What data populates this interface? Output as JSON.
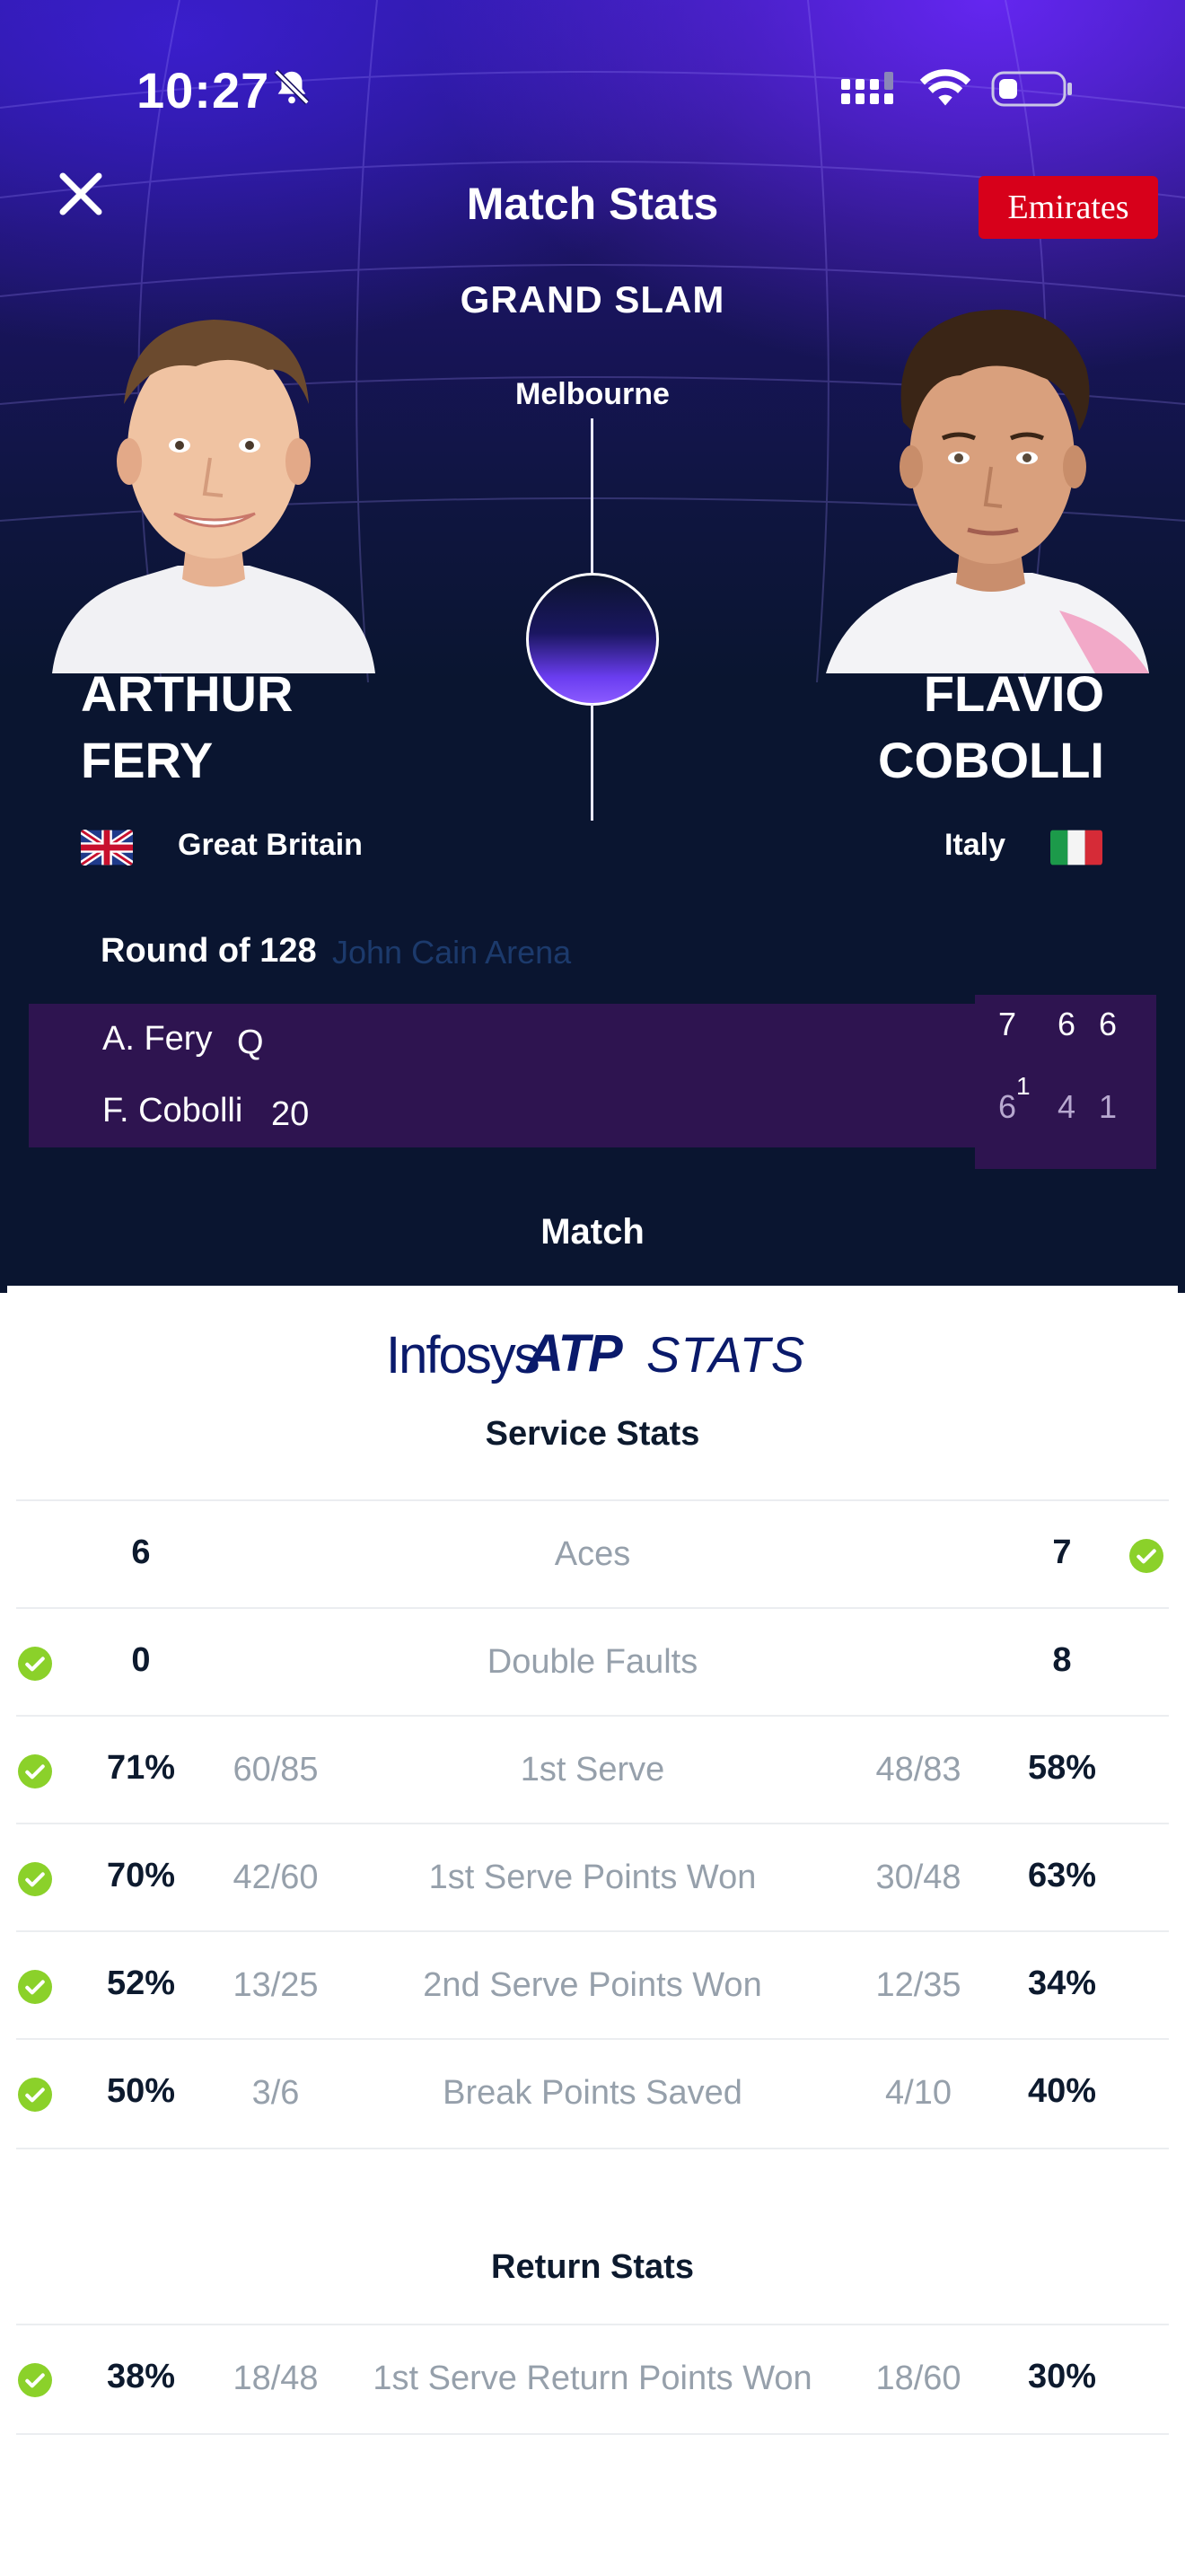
{
  "status_bar": {
    "time": "10:27"
  },
  "header": {
    "title": "Match Stats",
    "sponsor": "Emirates",
    "event": "GRAND SLAM",
    "city": "Melbourne"
  },
  "players": [
    {
      "first": "ARTHUR",
      "last": "FERY",
      "country": "Great Britain"
    },
    {
      "first": "FLAVIO",
      "last": "COBOLLI",
      "country": "Italy"
    }
  ],
  "match_info": {
    "round": "Round of 128",
    "court": "John Cain Arena"
  },
  "scoreboard": {
    "rows": [
      {
        "name": "A. Fery",
        "seed": "Q",
        "sets": [
          "7",
          "6",
          "6"
        ]
      },
      {
        "name": "F. Cobolli",
        "seed": "20",
        "sets": [
          "6",
          "4",
          "1"
        ],
        "tiebreak": "1"
      }
    ]
  },
  "tab": {
    "label": "Match"
  },
  "brand": {
    "infosys": "Infosys",
    "atp": "ATP",
    "stats": "STATS"
  },
  "service_stats": {
    "title": "Service Stats",
    "rows": [
      {
        "label": "Aces",
        "left": "6",
        "right": "7",
        "winner": "right"
      },
      {
        "label": "Double Faults",
        "left": "0",
        "right": "8",
        "winner": "left"
      },
      {
        "label": "1st Serve",
        "left": "71%",
        "left_frac": "60/85",
        "right_frac": "48/83",
        "right": "58%",
        "winner": "left"
      },
      {
        "label": "1st Serve Points Won",
        "left": "70%",
        "left_frac": "42/60",
        "right_frac": "30/48",
        "right": "63%",
        "winner": "left"
      },
      {
        "label": "2nd Serve Points Won",
        "left": "52%",
        "left_frac": "13/25",
        "right_frac": "12/35",
        "right": "34%",
        "winner": "left"
      },
      {
        "label": "Break Points Saved",
        "left": "50%",
        "left_frac": "3/6",
        "right_frac": "4/10",
        "right": "40%",
        "winner": "left"
      }
    ]
  },
  "return_stats": {
    "title": "Return Stats",
    "rows": [
      {
        "label": "1st Serve Return Points Won",
        "left": "38%",
        "left_frac": "18/48",
        "right_frac": "18/60",
        "right": "30%",
        "winner": "left"
      }
    ]
  },
  "colors": {
    "accent_check": "#8bd12a",
    "sponsor_red": "#d7001a",
    "score_bg": "#2e1450"
  },
  "icons": [
    "close-icon",
    "bell-slash-icon",
    "signal-icon",
    "wifi-icon",
    "battery-icon",
    "check-circle-icon"
  ]
}
